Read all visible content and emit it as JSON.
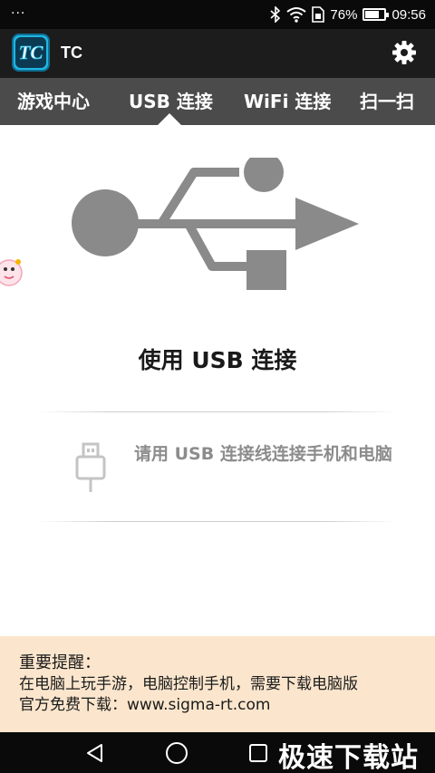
{
  "status_bar": {
    "dots": "···",
    "battery": "76%",
    "battery_level": 0.76,
    "time": "09:56"
  },
  "app_bar": {
    "logo_text": "TC",
    "title": "TC"
  },
  "tabs": [
    {
      "label": "游戏中心",
      "selected": false
    },
    {
      "label": "USB 连接",
      "selected": true
    },
    {
      "label": "WiFi 连接",
      "selected": false
    },
    {
      "label": "扫一扫",
      "selected": false
    }
  ],
  "main": {
    "title": "使用 USB 连接",
    "hint": "请用 USB 连接线连接手机和电脑"
  },
  "notice": {
    "heading": "重要提醒：",
    "line1": "在电脑上玩手游，电脑控制手机，需要下载电脑版",
    "line2": "官方免费下载：www.sigma-rt.com"
  },
  "watermark": "极速下载站",
  "colors": {
    "tab_bar": "#4b4b4b",
    "app_bar": "#1c1c1c",
    "notice_bg": "#fbe6cd",
    "usb_symbol": "#8a8a8a",
    "logo_accent": "#1fb6e0"
  }
}
